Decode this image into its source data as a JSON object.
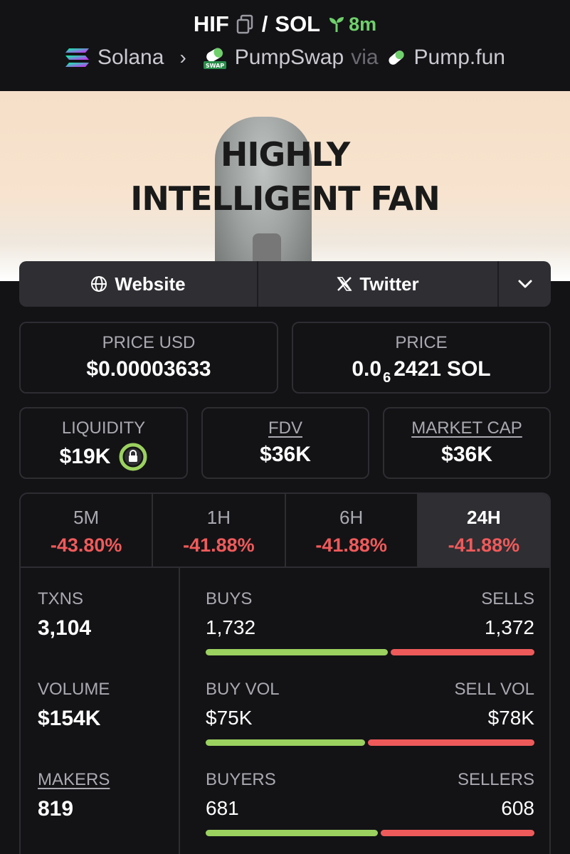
{
  "header": {
    "token": "HIF",
    "separator": "/",
    "quote": "SOL",
    "age": "8m",
    "chain": "Solana",
    "dex": "PumpSwap",
    "via": "via",
    "launchpad": "Pump.fun",
    "dex_badge": "SWAP"
  },
  "banner": {
    "line1": "HIGHLY",
    "line2": "INTELLIGENT FAN"
  },
  "links": {
    "website": "Website",
    "twitter": "Twitter"
  },
  "price_usd": {
    "label": "PRICE USD",
    "value": "$0.00003633"
  },
  "price_native": {
    "label": "PRICE",
    "prefix": "0.0",
    "zeros": "6",
    "digits": "2421",
    "unit": "SOL"
  },
  "liquidity": {
    "label": "LIQUIDITY",
    "value": "$19K"
  },
  "fdv": {
    "label": "FDV",
    "value": "$36K"
  },
  "market_cap": {
    "label": "MARKET CAP",
    "value": "$36K"
  },
  "changes": [
    {
      "label": "5M",
      "value": "-43.80%"
    },
    {
      "label": "1H",
      "value": "-41.88%"
    },
    {
      "label": "6H",
      "value": "-41.88%"
    },
    {
      "label": "24H",
      "value": "-41.88%"
    }
  ],
  "stats": {
    "txns": {
      "label": "TXNS",
      "value": "3,104"
    },
    "volume": {
      "label": "VOLUME",
      "value": "$154K"
    },
    "makers": {
      "label": "MAKERS",
      "value": "819"
    }
  },
  "splits": {
    "txns": {
      "left_label": "BUYS",
      "left_value": "1,732",
      "right_label": "SELLS",
      "right_value": "1,372",
      "buy_share": 0.558
    },
    "volume": {
      "left_label": "BUY VOL",
      "left_value": "$75K",
      "right_label": "SELL VOL",
      "right_value": "$78K",
      "buy_share": 0.49
    },
    "makers": {
      "left_label": "BUYERS",
      "left_value": "681",
      "right_label": "SELLERS",
      "right_value": "608",
      "buy_share": 0.528
    }
  },
  "colors": {
    "positive": "#9bd15f",
    "negative": "#ee5a5a",
    "age_green": "#6fd06b",
    "background": "#131316"
  }
}
